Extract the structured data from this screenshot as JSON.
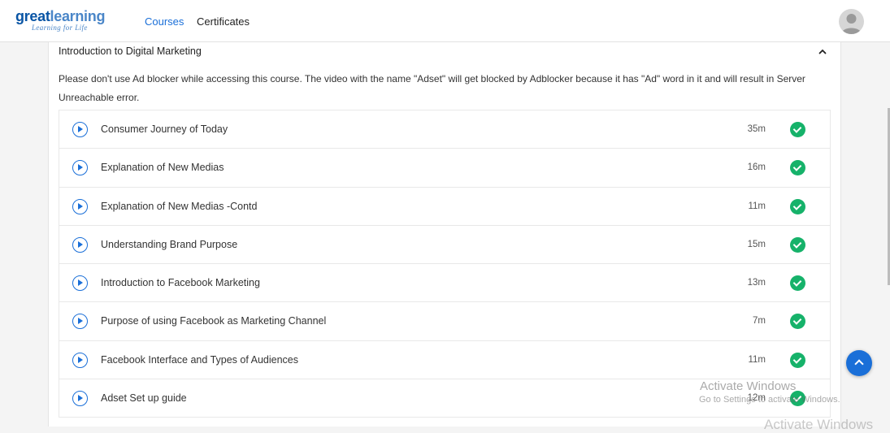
{
  "header": {
    "logo_prefix": "great",
    "logo_suffix": "learning",
    "logo_tagline": "Learning for Life",
    "nav": [
      {
        "label": "Courses",
        "active": true
      },
      {
        "label": "Certificates",
        "active": false
      }
    ],
    "avatar_icon": "user-avatar-icon"
  },
  "section": {
    "title": "Introduction to Digital Marketing",
    "expanded": true,
    "notice": "Please don't use Ad blocker while accessing this course. The video with the name \"Adset\" will get blocked by Adblocker because it has \"Ad\" word in it and will result in Server Unreachable error.",
    "lessons": [
      {
        "title": "Consumer Journey of Today",
        "duration": "35m",
        "completed": true
      },
      {
        "title": "Explanation of New Medias",
        "duration": "16m",
        "completed": true
      },
      {
        "title": "Explanation of New Medias -Contd",
        "duration": "11m",
        "completed": true
      },
      {
        "title": "Understanding Brand Purpose",
        "duration": "15m",
        "completed": true
      },
      {
        "title": "Introduction to Facebook Marketing",
        "duration": "13m",
        "completed": true
      },
      {
        "title": "Purpose of using Facebook as Marketing Channel",
        "duration": "7m",
        "completed": true
      },
      {
        "title": "Facebook Interface and Types of Audiences",
        "duration": "11m",
        "completed": true
      },
      {
        "title": "Adset Set up guide",
        "duration": "12m",
        "completed": true
      }
    ]
  },
  "watermark": {
    "title": "Activate Windows",
    "subtitle": "Go to Settings to activate Windows.",
    "ghost": "Activate Windows"
  },
  "colors": {
    "accent": "#1a6fd8",
    "complete": "#16b26a",
    "logo_dark": "#0a55a5",
    "logo_light": "#4a86c8"
  }
}
